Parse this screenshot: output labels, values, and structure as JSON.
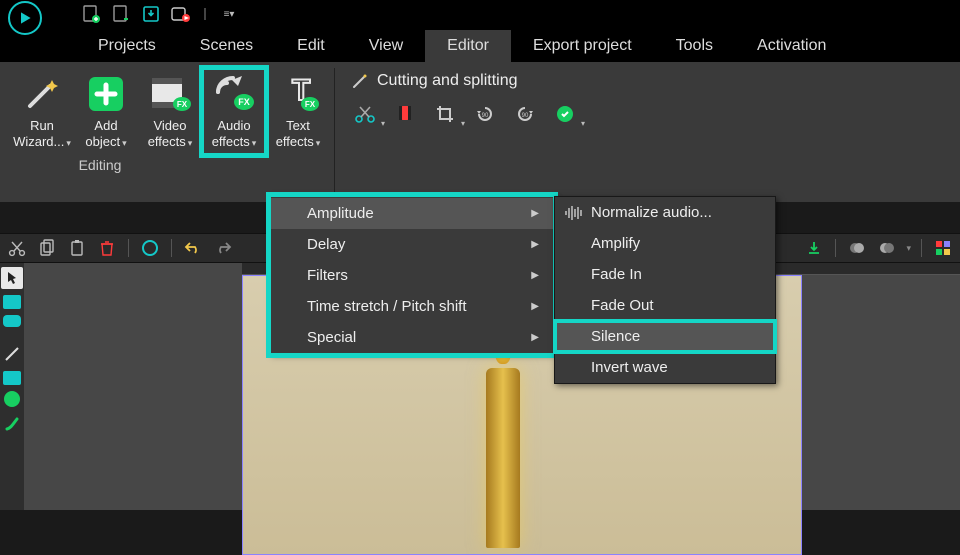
{
  "qat": {
    "tips": [
      "doc1",
      "doc2",
      "save",
      "record",
      "more"
    ]
  },
  "menu": {
    "items": [
      "Projects",
      "Scenes",
      "Edit",
      "View",
      "Editor",
      "Export project",
      "Tools",
      "Activation"
    ],
    "active_index": 4
  },
  "ribbon": {
    "buttons": [
      {
        "label_line1": "Run",
        "label_line2": "Wizard..."
      },
      {
        "label_line1": "Add",
        "label_line2": "object"
      },
      {
        "label_line1": "Video",
        "label_line2": "effects"
      },
      {
        "label_line1": "Audio",
        "label_line2": "effects"
      },
      {
        "label_line1": "Text",
        "label_line2": "effects"
      }
    ],
    "group_label": "Editing",
    "cutting_label": "Cutting and splitting"
  },
  "dropdown1": {
    "items": [
      {
        "label": "Amplitude"
      },
      {
        "label": "Delay"
      },
      {
        "label": "Filters"
      },
      {
        "label": "Time stretch / Pitch shift"
      },
      {
        "label": "Special"
      }
    ]
  },
  "dropdown2": {
    "items": [
      {
        "label": "Normalize audio..."
      },
      {
        "label": "Amplify"
      },
      {
        "label": "Fade In"
      },
      {
        "label": "Fade Out"
      },
      {
        "label": "Silence"
      },
      {
        "label": "Invert wave"
      }
    ],
    "highlight_index": 4
  },
  "colors": {
    "accent": "#15d6c6",
    "green": "#17cf61",
    "red": "#ff3b3b"
  }
}
